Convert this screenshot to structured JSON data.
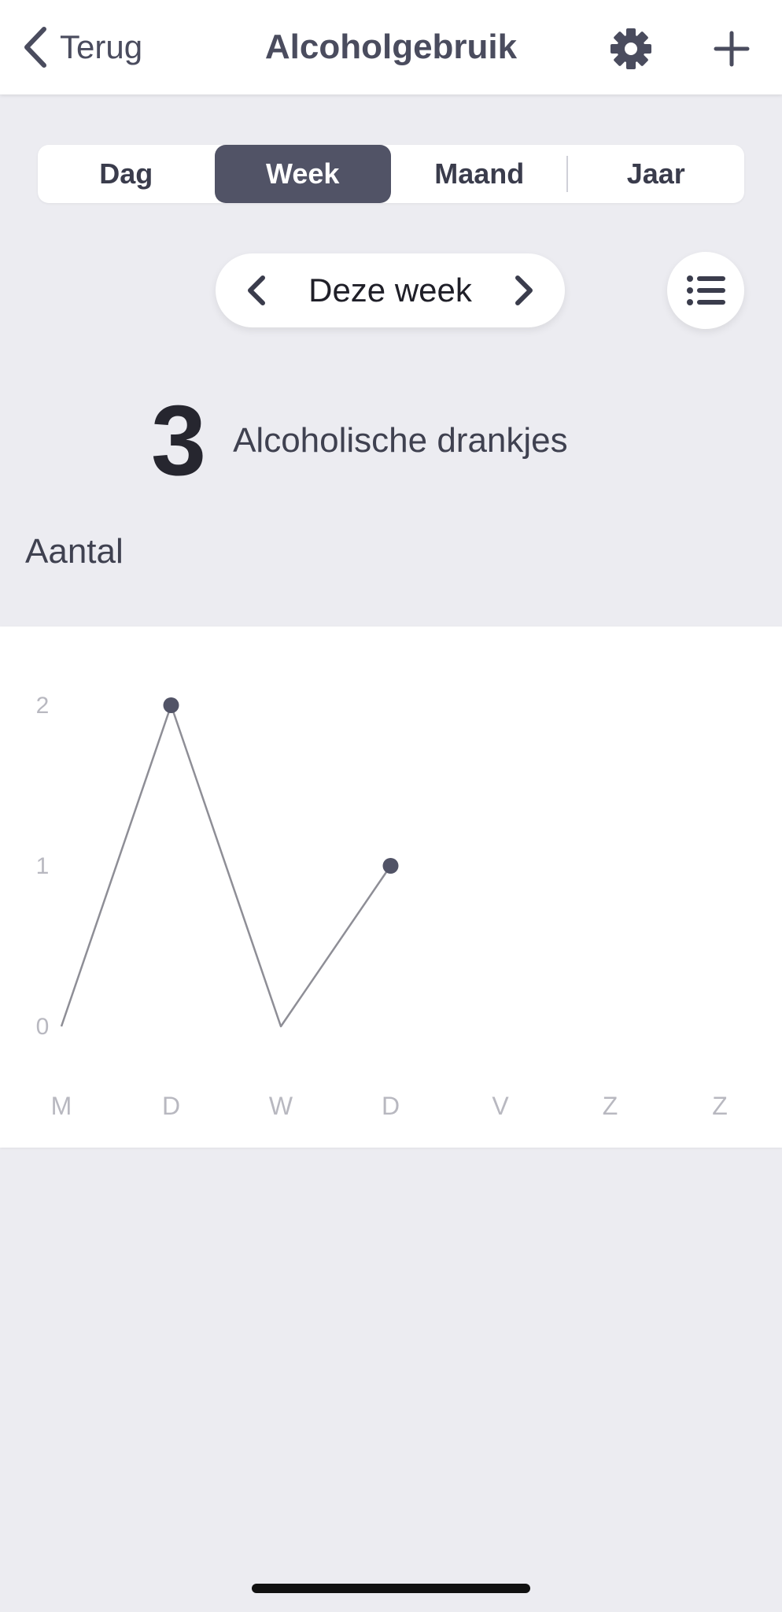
{
  "navbar": {
    "back_label": "Terug",
    "title": "Alcoholgebruik",
    "settings_icon": "gear-icon",
    "add_icon": "plus-icon"
  },
  "segments": [
    {
      "label": "Dag",
      "active": false
    },
    {
      "label": "Week",
      "active": true
    },
    {
      "label": "Maand",
      "active": false
    },
    {
      "label": "Jaar",
      "active": false
    }
  ],
  "period": {
    "label": "Deze week",
    "prev_icon": "chevron-left-icon",
    "next_icon": "chevron-right-icon"
  },
  "list_icon": "list-icon",
  "summary": {
    "count": "3",
    "label": "Alcoholische drankjes"
  },
  "section_title": "Aantal",
  "colors": {
    "accent": "#515366",
    "background": "#ececf1",
    "card": "#ffffff",
    "line": "#8e8e96",
    "tick": "#b8b8c0"
  },
  "chart_data": {
    "type": "line",
    "categories": [
      "M",
      "D",
      "W",
      "D",
      "V",
      "Z",
      "Z"
    ],
    "series": [
      {
        "values": [
          0,
          2,
          0,
          1,
          null,
          null,
          null
        ]
      }
    ],
    "markers": [
      false,
      true,
      false,
      true,
      false,
      false,
      false
    ],
    "yticks": [
      0,
      1,
      2
    ],
    "ylim": [
      0,
      2
    ],
    "grid": false
  }
}
